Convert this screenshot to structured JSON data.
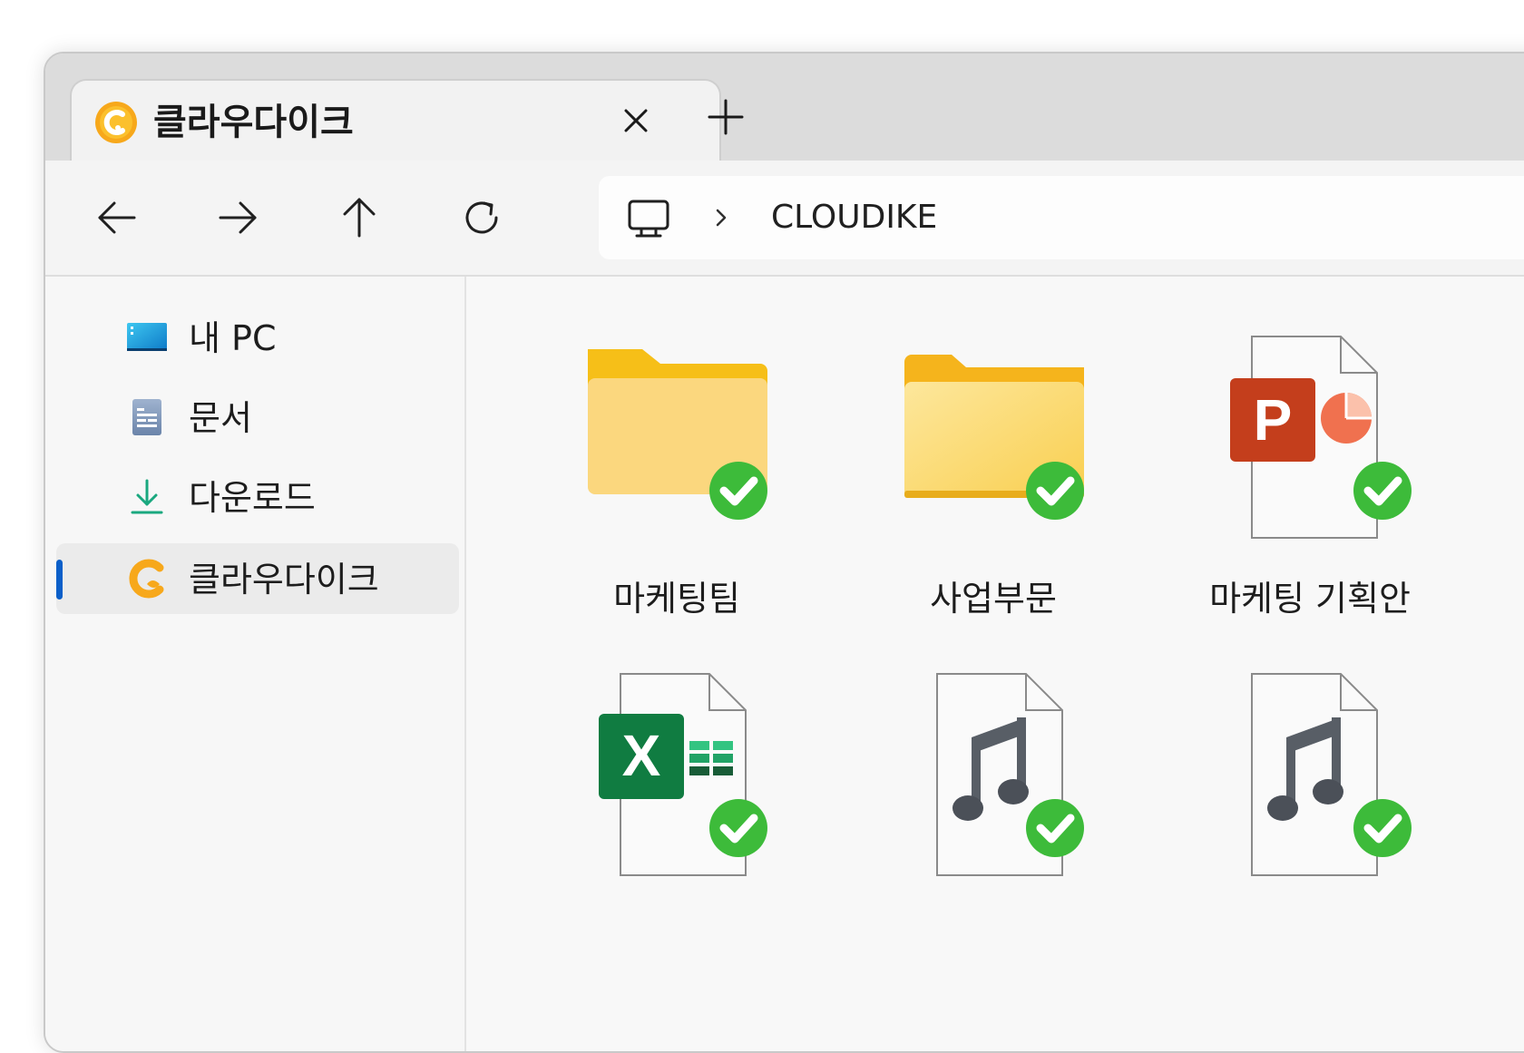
{
  "tab": {
    "title": "클라우다이크"
  },
  "address": {
    "path": "CLOUDIKE"
  },
  "sidebar": {
    "items": [
      {
        "label": "내 PC",
        "icon": "pc-icon"
      },
      {
        "label": "문서",
        "icon": "document-icon"
      },
      {
        "label": "다운로드",
        "icon": "download-icon"
      },
      {
        "label": "클라우다이크",
        "icon": "cloudike-icon",
        "selected": true
      }
    ]
  },
  "files": [
    {
      "name": "마케팅팀",
      "type": "folder",
      "status": "synced"
    },
    {
      "name": "사업부문",
      "type": "folder",
      "status": "synced"
    },
    {
      "name": "마케팅 기획안",
      "type": "powerpoint",
      "status": "synced"
    },
    {
      "name": "",
      "type": "excel",
      "status": "synced"
    },
    {
      "name": "",
      "type": "audio",
      "status": "synced"
    },
    {
      "name": "",
      "type": "audio",
      "status": "synced"
    }
  ],
  "colors": {
    "accent": "#0a5fc9",
    "synced": "#3dbb3a",
    "folder": "#fbd56f",
    "powerpoint": "#c43e1c",
    "excel": "#107c41",
    "cloudike": "#f7a81b"
  }
}
